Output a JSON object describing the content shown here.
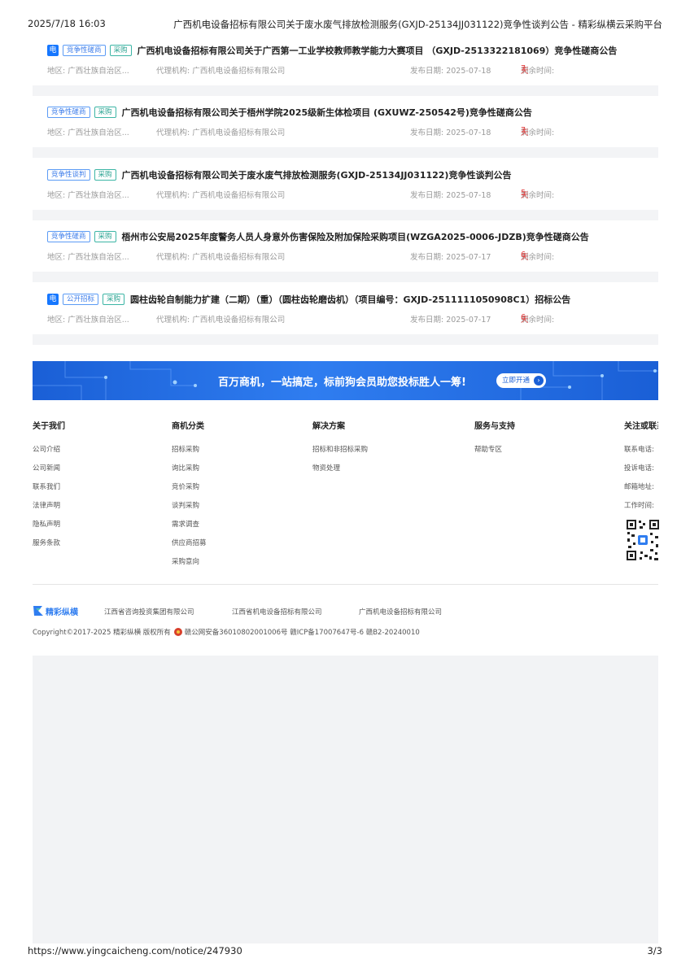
{
  "print_header": {
    "datetime": "2025/7/18 16:03",
    "document_title": "广西机电设备招标有限公司关于废水废气排放检测服务(GXJD-25134JJ031122)竞争性谈判公告 - 精彩纵横云采购平台"
  },
  "notices": [
    {
      "electronic": true,
      "electronic_label": "电",
      "type_tag": "竞争性磋商",
      "category_tag": "采购",
      "title": "广西机电设备招标有限公司关于广西第一工业学校教师教学能力大赛项目 （GXJD-2513322181069）竞争性磋商公告",
      "region": "地区: 广西壮族自治区...",
      "agency": "代理机构: 广西机电设备招标有限公司",
      "publish_date": "发布日期:  2025-07-18",
      "remaining_label": "剩余时间:",
      "remaining_days": "7",
      "days_unit": "天"
    },
    {
      "electronic": false,
      "electronic_label": "",
      "type_tag": "竞争性磋商",
      "category_tag": "采购",
      "title": "广西机电设备招标有限公司关于梧州学院2025级新生体检项目 (GXUWZ-250542号)竞争性磋商公告",
      "region": "地区: 广西壮族自治区...",
      "agency": "代理机构: 广西机电设备招标有限公司",
      "publish_date": "发布日期:  2025-07-18",
      "remaining_label": "剩余时间:",
      "remaining_days": "7",
      "days_unit": "天"
    },
    {
      "electronic": false,
      "electronic_label": "",
      "type_tag": "竞争性谈判",
      "category_tag": "采购",
      "title": "广西机电设备招标有限公司关于废水废气排放检测服务(GXJD-25134JJ031122)竞争性谈判公告",
      "region": "地区: 广西壮族自治区...",
      "agency": "代理机构: 广西机电设备招标有限公司",
      "publish_date": "发布日期:  2025-07-18",
      "remaining_label": "剩余时间:",
      "remaining_days": "5",
      "days_unit": "天"
    },
    {
      "electronic": false,
      "electronic_label": "",
      "type_tag": "竞争性磋商",
      "category_tag": "采购",
      "title": "梧州市公安局2025年度警务人员人身意外伤害保险及附加保险采购项目(WZGA2025-0006-JDZB)竞争性磋商公告",
      "region": "地区: 广西壮族自治区...",
      "agency": "代理机构: 广西机电设备招标有限公司",
      "publish_date": "发布日期:  2025-07-17",
      "remaining_label": "剩余时间:",
      "remaining_days": "6",
      "days_unit": "天"
    },
    {
      "electronic": true,
      "electronic_label": "电",
      "type_tag": "公开招标",
      "category_tag": "采购",
      "title": "圆柱齿轮自制能力扩建（二期）（重）（圆柱齿轮磨齿机）（项目编号：GXJD-2511111050908C1）招标公告",
      "region": "地区: 广西壮族自治区...",
      "agency": "代理机构: 广西机电设备招标有限公司",
      "publish_date": "发布日期:  2025-07-17",
      "remaining_label": "剩余时间:",
      "remaining_days": "6",
      "days_unit": "天"
    }
  ],
  "banner": {
    "text": "百万商机，一站搞定，标前狗会员助您投标胜人一筹!",
    "button_label": "立即开通"
  },
  "footer": {
    "about": {
      "heading": "关于我们",
      "items": [
        "公司介绍",
        "公司新闻",
        "联系我们",
        "法律声明",
        "隐私声明",
        "服务条款"
      ]
    },
    "categories": {
      "heading": "商机分类",
      "items": [
        "招标采购",
        "询比采购",
        "竞价采购",
        "谈判采购",
        "需求调查",
        "供应商招募",
        "采购意向"
      ]
    },
    "solutions": {
      "heading": "解决方案",
      "items": [
        "招标和非招标采购",
        "物资处理"
      ]
    },
    "service": {
      "heading": "服务与支持",
      "items": [
        "帮助专区"
      ]
    },
    "follow": {
      "heading": "关注或联系",
      "items": [
        "联系电话:",
        "投诉电话:",
        "邮箱地址:",
        "工作时间:"
      ]
    },
    "partners": [
      "江西省咨询投资集团有限公司",
      "江西省机电设备招标有限公司",
      "广西机电设备招标有限公司"
    ],
    "logo_text": "精彩纵横",
    "copyright": "Copyright©2017-2025  精彩纵横  版权所有",
    "police_record": "赣公网安备36010802001006号  赣ICP备17007647号-6  赣B2-20240010"
  },
  "print_footer": {
    "url": "https://www.yingcaicheng.com/notice/247930",
    "page": "3/3"
  },
  "colors": {
    "accent": "#1677ff",
    "tag_blue": "#3a7bea",
    "tag_green": "#2aa391",
    "days_red": "#e34040",
    "banner": "#2f7df0"
  }
}
